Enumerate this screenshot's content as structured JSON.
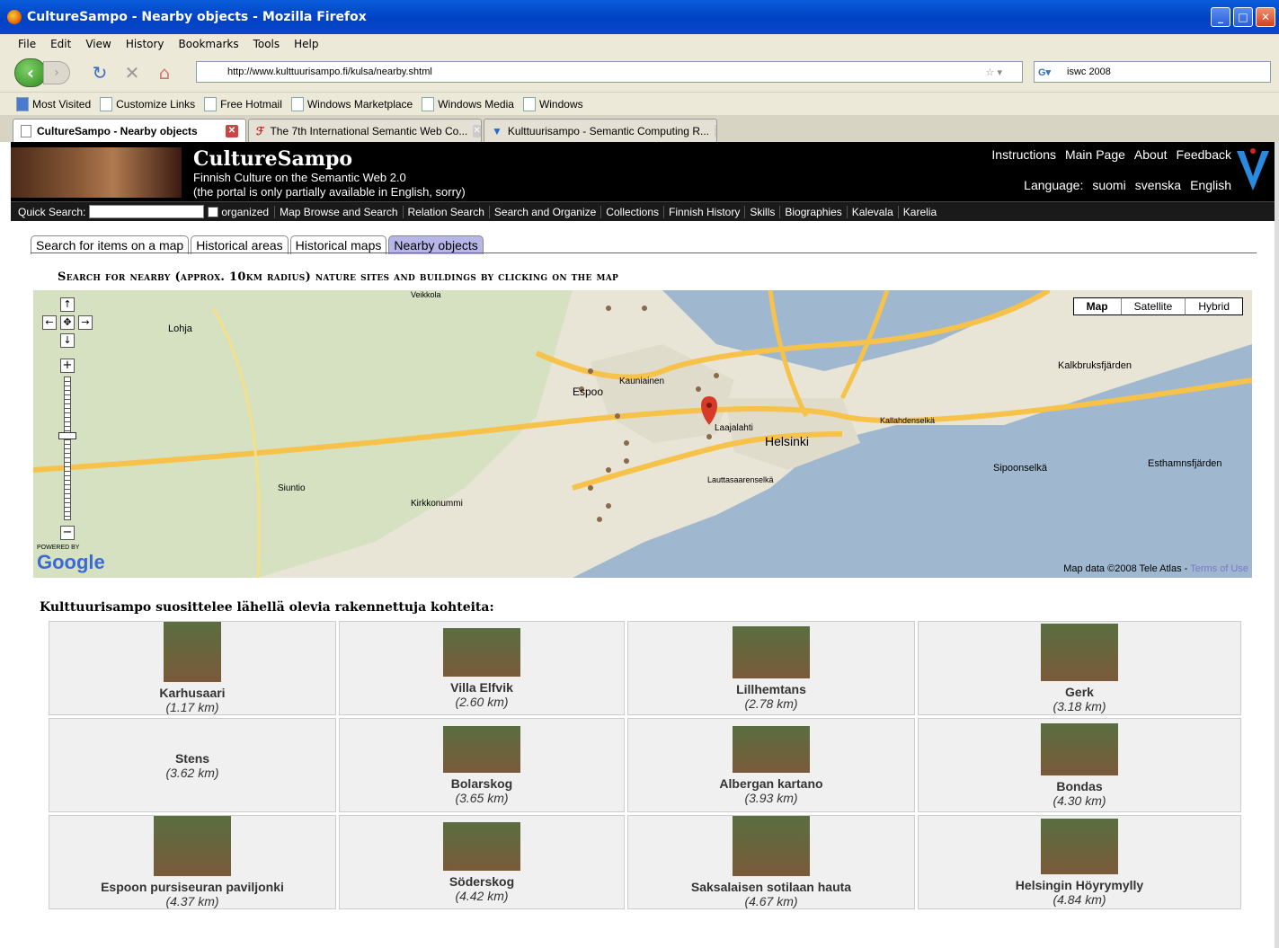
{
  "window": {
    "title": "CultureSampo - Nearby objects - Mozilla Firefox"
  },
  "menu": [
    "File",
    "Edit",
    "View",
    "History",
    "Bookmarks",
    "Tools",
    "Help"
  ],
  "address": {
    "url": "http://www.kulttuurisampo.fi/kulsa/nearby.shtml",
    "search": "iswc 2008"
  },
  "bookmarks": [
    "Most Visited",
    "Customize Links",
    "Free Hotmail",
    "Windows Marketplace",
    "Windows Media",
    "Windows"
  ],
  "tabs": [
    {
      "label": "CultureSampo - Nearby objects"
    },
    {
      "label": "The 7th International Semantic Web Co..."
    },
    {
      "label": "Kulttuurisampo - Semantic Computing R..."
    }
  ],
  "site": {
    "brand": "CultureSampo",
    "tagline1": "Finnish Culture on the Semantic Web 2.0",
    "tagline2": "(the portal is only partially available in English, sorry)",
    "toplinks": [
      "Instructions",
      "Main Page",
      "About",
      "Feedback"
    ],
    "lang_label": "Language:",
    "langs": [
      "suomi",
      "svenska",
      "English"
    ],
    "quick_search": "Quick Search:",
    "organized": "organized",
    "subnav": [
      "Map Browse and Search",
      "Relation Search",
      "Search and Organize",
      "Collections",
      "Finnish History",
      "Skills",
      "Biographies",
      "Kalevala",
      "Karelia"
    ]
  },
  "map_tabs": [
    "Search for items on a map",
    "Historical areas",
    "Historical maps",
    "Nearby objects"
  ],
  "heading": "Search for nearby (approx. 10km radius) nature sites and buildings by clicking on the map",
  "map": {
    "buttons": [
      "Map",
      "Satellite",
      "Hybrid"
    ],
    "labels": [
      "Lohja",
      "Espoo",
      "Kauniainen",
      "Helsinki",
      "Laajalahti",
      "Kalkbruksfjärden",
      "Sipoonselkä",
      "Esthamnsfjärden",
      "Siuntio",
      "Kirkkonummi",
      "Lauttasaarenselkä",
      "Kallahdenselkä",
      "Veikkola"
    ],
    "powered": "POWERED BY",
    "google": "Google",
    "copyright": "Map data ©2008 Tele Atlas - ",
    "terms": "Terms of Use"
  },
  "recs_title": "Kulttuurisampo suosittelee lähellä olevia rakennettuja kohteita:",
  "items": [
    {
      "name": "Karhusaari",
      "dist": "(1.17 km)"
    },
    {
      "name": "Villa Elfvik",
      "dist": "(2.60 km)"
    },
    {
      "name": "Lillhemtans",
      "dist": "(2.78 km)"
    },
    {
      "name": "Gerk",
      "dist": "(3.18 km)"
    },
    {
      "name": "Stens",
      "dist": "(3.62 km)"
    },
    {
      "name": "Bolarskog",
      "dist": "(3.65 km)"
    },
    {
      "name": "Albergan kartano",
      "dist": "(3.93 km)"
    },
    {
      "name": "Bondas",
      "dist": "(4.30 km)"
    },
    {
      "name": "Espoon pursiseuran paviljonki",
      "dist": "(4.37 km)"
    },
    {
      "name": "Söderskog",
      "dist": "(4.42 km)"
    },
    {
      "name": "Saksalaisen sotilaan hauta",
      "dist": "(4.67 km)"
    },
    {
      "name": "Helsingin Höyrymylly",
      "dist": "(4.84 km)"
    }
  ]
}
